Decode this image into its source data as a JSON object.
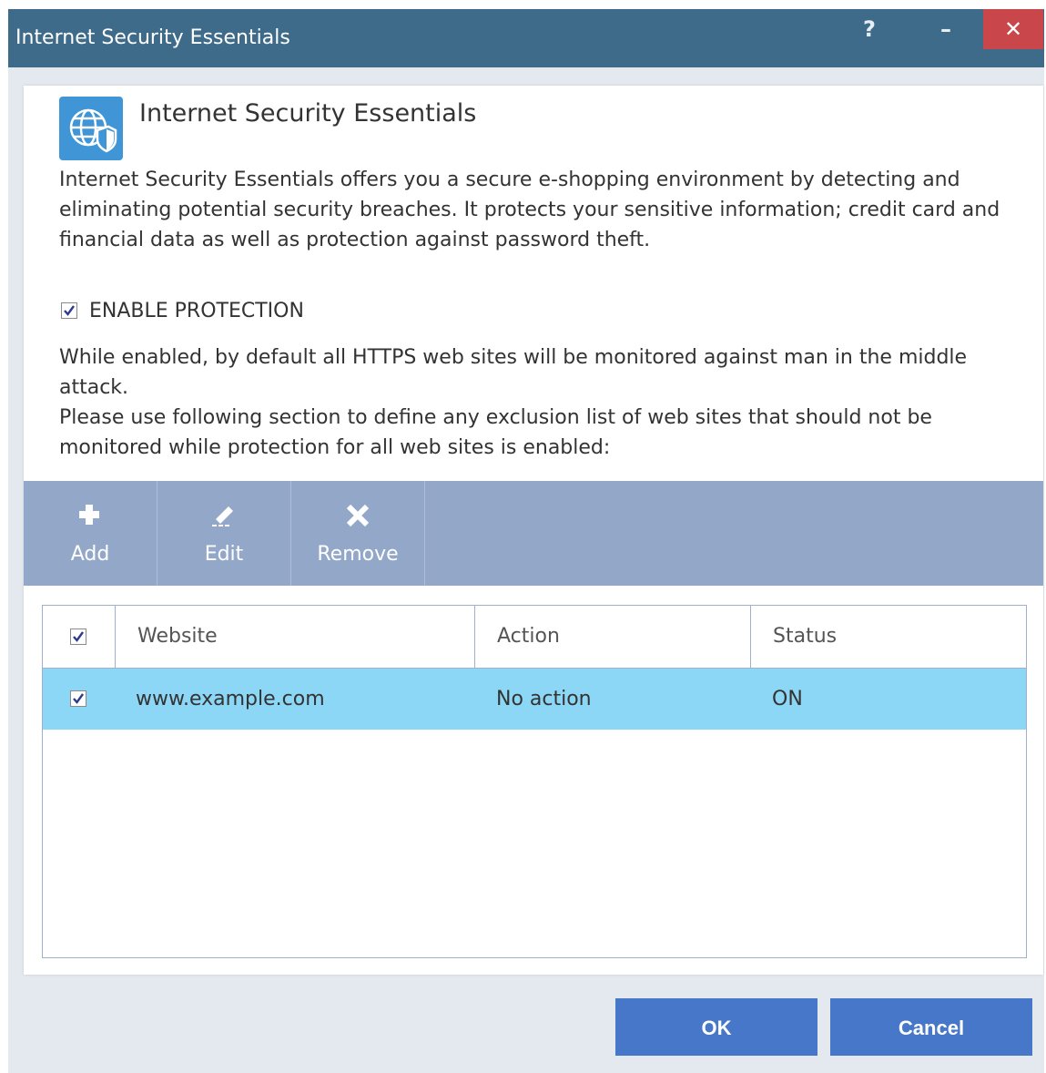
{
  "window": {
    "title": "Internet Security Essentials",
    "help_label": "?",
    "minimize_label": "–",
    "close_label": "✕"
  },
  "header": {
    "title": "Internet Security Essentials",
    "icon": "globe-shield-icon",
    "description": "Internet Security Essentials offers you a secure e-shopping environment by detecting and eliminating potential security breaches. It protects your sensitive information; credit card and financial data as well as protection against password theft."
  },
  "protection": {
    "label": "ENABLE PROTECTION",
    "checked": true
  },
  "info": {
    "line1": "While enabled, by default all HTTPS web sites will be monitored against man in the middle attack.",
    "line2": "Please use following section to define any exclusion list of web sites that should not be monitored while protection for all web sites is enabled:"
  },
  "toolbar": {
    "add_label": "Add",
    "edit_label": "Edit",
    "remove_label": "Remove"
  },
  "table": {
    "columns": [
      "Website",
      "Action",
      "Status"
    ],
    "rows": [
      {
        "checked": true,
        "website": "www.example.com",
        "action": "No action",
        "status": "ON"
      }
    ]
  },
  "footer": {
    "ok_label": "OK",
    "cancel_label": "Cancel"
  },
  "colors": {
    "titlebar": "#3f6b8b",
    "close": "#c9474a",
    "toolbar": "#93a7c9",
    "selected_row": "#8cd6f6",
    "button": "#4777c8"
  }
}
